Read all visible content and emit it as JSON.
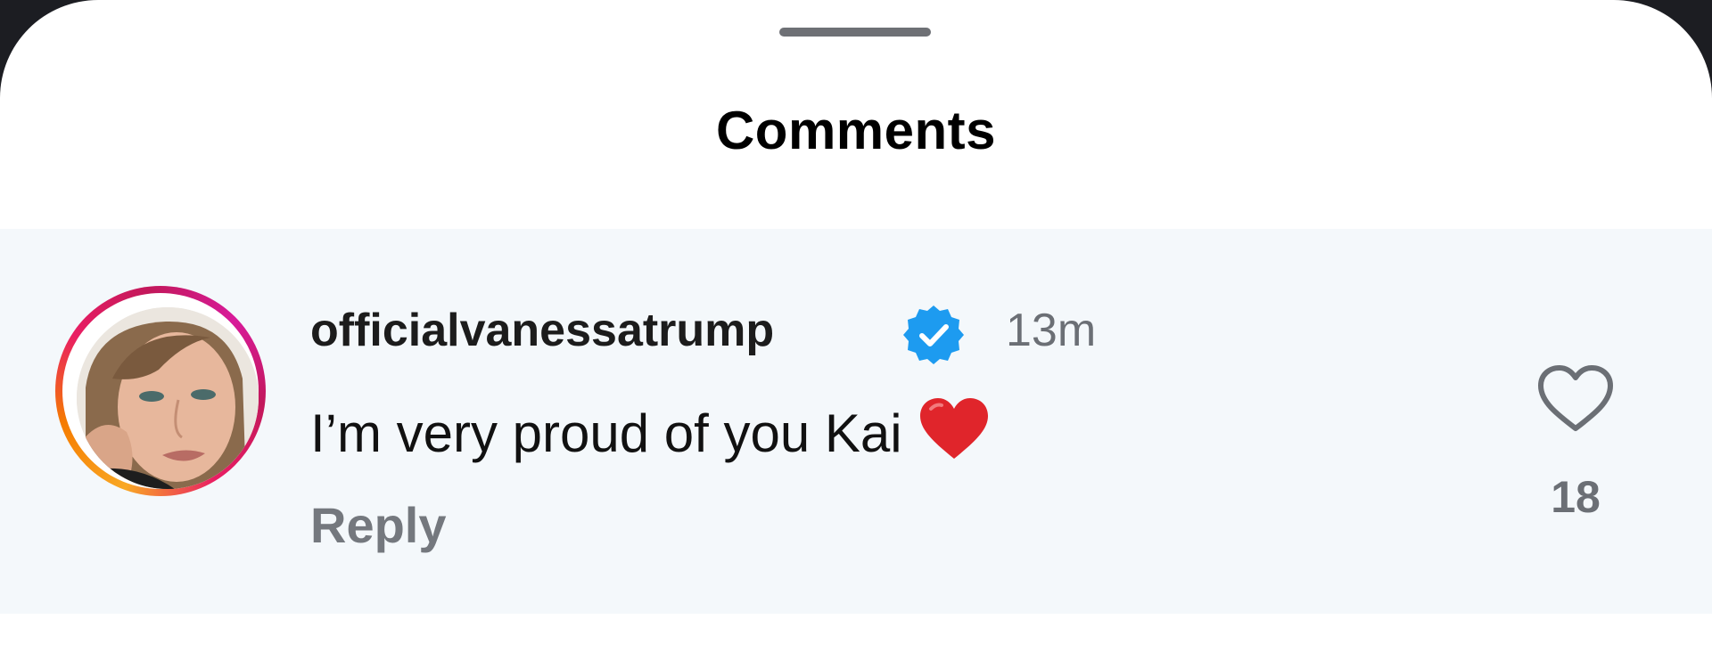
{
  "sheet": {
    "title": "Comments"
  },
  "comment": {
    "username": "officialvanessatrump",
    "verified": true,
    "timestamp": "13m",
    "text": "I’m very proud of you Kai",
    "emoji": "red-heart-emoji",
    "reply_label": "Reply",
    "like_count": "18"
  },
  "icons": {
    "verified": "verified-badge-icon",
    "like": "heart-outline-icon"
  },
  "colors": {
    "verified_blue": "#1d9bf0",
    "heart_red": "#e0252b",
    "row_background": "#f4f8fb",
    "muted_text": "#6b6f75"
  }
}
